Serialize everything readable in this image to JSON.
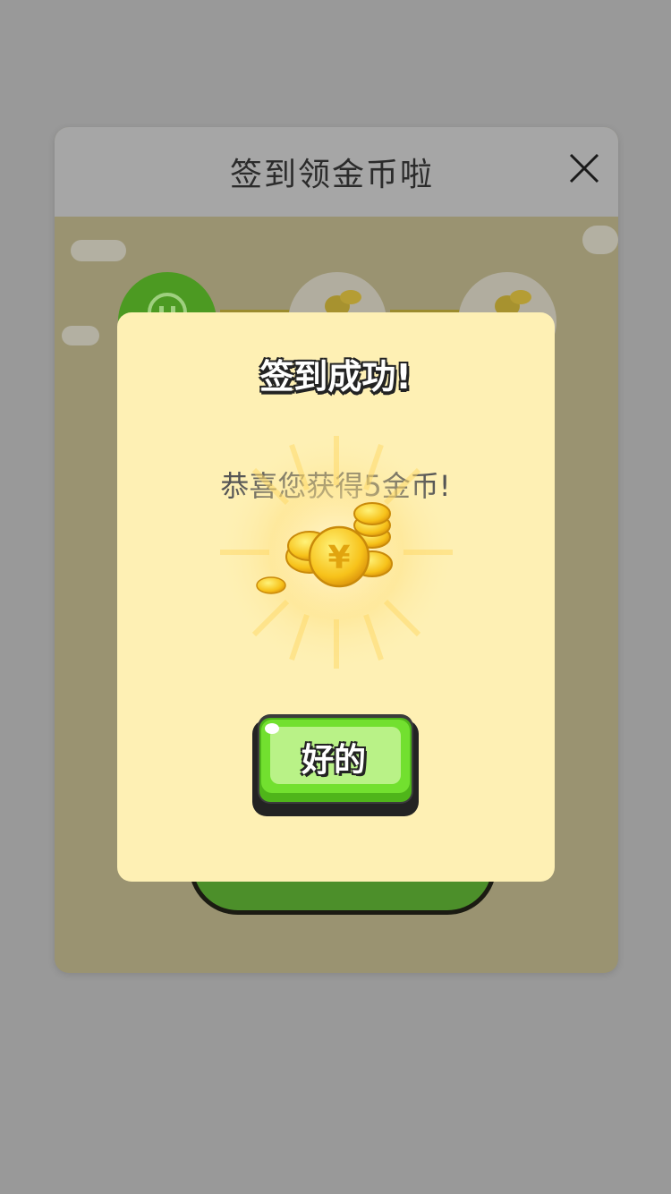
{
  "background_panel": {
    "title": "签到领金币啦",
    "close_icon": "close-icon",
    "day_icons": [
      "smiley-icon",
      "coin-stack-icon",
      "coin-stack-icon"
    ]
  },
  "modal": {
    "title": "签到成功!",
    "message": "恭喜您获得5金币!",
    "reward_icon": "gold-coins-icon",
    "ok_label": "好的"
  },
  "colors": {
    "overlay": "#999999",
    "modal_bg": "#fef0b4",
    "button_green": "#6bd82e",
    "coin_gold": "#f7c21a"
  }
}
